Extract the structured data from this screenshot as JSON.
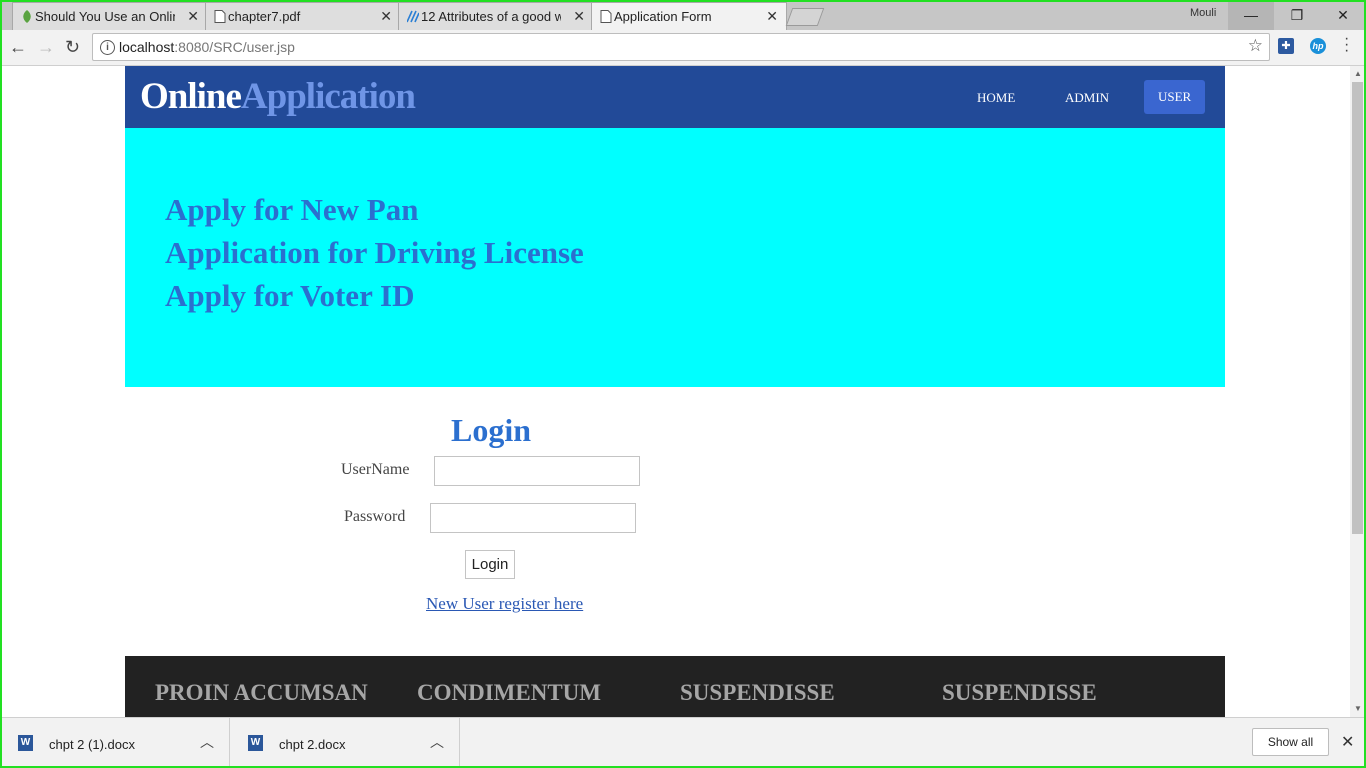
{
  "browser": {
    "tabs": [
      {
        "title": "Should You Use an Online",
        "icon": "leaf-icon",
        "active": false
      },
      {
        "title": "chapter7.pdf",
        "icon": "document-icon",
        "active": false
      },
      {
        "title": "12 Attributes of a good w",
        "icon": "stripes-icon",
        "active": false
      },
      {
        "title": "Application Form",
        "icon": "document-icon",
        "active": true
      }
    ],
    "profile_name": "Mouli",
    "url_host": "localhost",
    "url_rest": ":8080/SRC/user.jsp"
  },
  "site": {
    "logo_part1": "Online",
    "logo_part2": "Application",
    "nav": {
      "home": "HOME",
      "admin": "ADMIN",
      "user": "USER"
    },
    "hero_links": [
      "Apply for New Pan",
      "Application for Driving License",
      "Apply for Voter ID"
    ],
    "login": {
      "title": "Login",
      "username_label": "UserName",
      "password_label": "Password",
      "username_value": "",
      "password_value": "",
      "button_label": "Login",
      "register_link": "New User register here"
    },
    "footer_columns": [
      "PROIN ACCUMSAN",
      "CONDIMENTUM",
      "SUSPENDISSE",
      "SUSPENDISSE"
    ]
  },
  "downloads": {
    "items": [
      "chpt 2 (1).docx",
      "chpt 2.docx"
    ],
    "show_all": "Show all"
  },
  "colors": {
    "header": "#224a98",
    "hero": "#00ffff",
    "accent_text": "#2b6fcf",
    "footer": "#222222"
  }
}
